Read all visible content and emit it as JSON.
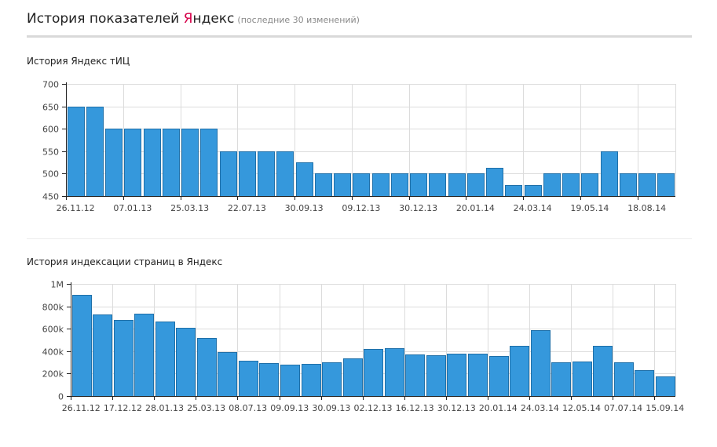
{
  "header": {
    "title_main": "История показателей ",
    "brand_first_letter": "Я",
    "brand_rest": "ндекс",
    "subtitle": "(последние 30 изменений)"
  },
  "colors": {
    "bar": "#3598dc",
    "bar_border": "#1f6fa8",
    "brand": "#d6004a",
    "grid": "#dcdcdc"
  },
  "chart_data": [
    {
      "type": "bar",
      "title": "История Яндекс тИЦ",
      "ylim": [
        450,
        700
      ],
      "yticks": [
        {
          "value": 450,
          "label": "450"
        },
        {
          "value": 500,
          "label": "500"
        },
        {
          "value": 550,
          "label": "550"
        },
        {
          "value": 600,
          "label": "600"
        },
        {
          "value": 650,
          "label": "650"
        },
        {
          "value": 700,
          "label": "700"
        }
      ],
      "values": [
        650,
        650,
        600,
        600,
        600,
        600,
        600,
        600,
        550,
        550,
        550,
        550,
        525,
        500,
        500,
        500,
        500,
        500,
        500,
        500,
        500,
        500,
        513,
        475,
        475,
        500,
        500,
        500,
        550,
        500,
        500,
        500
      ],
      "xtick_labels": [
        {
          "index": 0,
          "label": "26.11.12"
        },
        {
          "index": 3,
          "label": "07.01.13"
        },
        {
          "index": 6,
          "label": "25.03.13"
        },
        {
          "index": 9,
          "label": "22.07.13"
        },
        {
          "index": 12,
          "label": "30.09.13"
        },
        {
          "index": 15,
          "label": "09.12.13"
        },
        {
          "index": 18,
          "label": "30.12.13"
        },
        {
          "index": 21,
          "label": "20.01.14"
        },
        {
          "index": 24,
          "label": "24.03.14"
        },
        {
          "index": 27,
          "label": "19.05.14"
        },
        {
          "index": 30,
          "label": "18.08.14"
        }
      ],
      "grid": true
    },
    {
      "type": "bar",
      "title": "История индексации страниц в Яндекс",
      "ylim": [
        0,
        1000000
      ],
      "yticks": [
        {
          "value": 0,
          "label": "0"
        },
        {
          "value": 200000,
          "label": "200k"
        },
        {
          "value": 400000,
          "label": "400k"
        },
        {
          "value": 600000,
          "label": "600k"
        },
        {
          "value": 800000,
          "label": "800k"
        },
        {
          "value": 1000000,
          "label": "1M"
        }
      ],
      "values": [
        905000,
        730000,
        680000,
        735000,
        665000,
        605000,
        520000,
        395000,
        315000,
        295000,
        280000,
        285000,
        300000,
        335000,
        420000,
        425000,
        370000,
        365000,
        375000,
        380000,
        355000,
        450000,
        590000,
        300000,
        310000,
        450000,
        300000,
        230000,
        175000
      ],
      "xtick_labels": [
        {
          "index": 0,
          "label": "26.11.12"
        },
        {
          "index": 2,
          "label": "17.12.12"
        },
        {
          "index": 4,
          "label": "28.01.13"
        },
        {
          "index": 6,
          "label": "25.03.13"
        },
        {
          "index": 8,
          "label": "08.07.13"
        },
        {
          "index": 10,
          "label": "09.09.13"
        },
        {
          "index": 12,
          "label": "30.09.13"
        },
        {
          "index": 14,
          "label": "02.12.13"
        },
        {
          "index": 16,
          "label": "16.12.13"
        },
        {
          "index": 18,
          "label": "30.12.13"
        },
        {
          "index": 20,
          "label": "20.01.14"
        },
        {
          "index": 22,
          "label": "24.03.14"
        },
        {
          "index": 24,
          "label": "12.05.14"
        },
        {
          "index": 26,
          "label": "07.07.14"
        },
        {
          "index": 28,
          "label": "15.09.14"
        }
      ],
      "grid": true
    }
  ]
}
